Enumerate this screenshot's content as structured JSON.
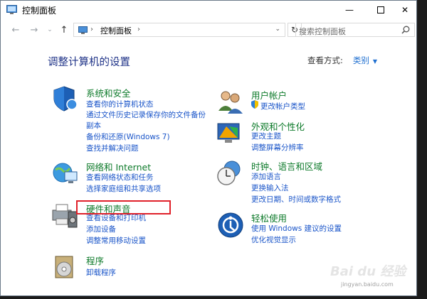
{
  "window": {
    "title": "控制面板"
  },
  "nav": {
    "breadcrumb": "控制面板",
    "search_placeholder": "搜索控制面板"
  },
  "main": {
    "heading": "调整计算机的设置",
    "view_by_label": "查看方式:",
    "view_by_value": "类别"
  },
  "categories": {
    "system": {
      "title": "系统和安全",
      "links": [
        "查看你的计算机状态",
        "通过文件历史记录保存你的文件备份",
        "副本",
        "备份和还原(Windows 7)",
        "查找并解决问题"
      ]
    },
    "network": {
      "title": "网络和 Internet",
      "links": [
        "查看网络状态和任务",
        "选择家庭组和共享选项"
      ]
    },
    "hardware": {
      "title": "硬件和声音",
      "links": [
        "查看设备和打印机",
        "添加设备",
        "调整常用移动设置"
      ]
    },
    "programs": {
      "title": "程序",
      "links": [
        "卸载程序"
      ]
    },
    "user": {
      "title": "用户帐户",
      "links": [
        "更改帐户类型"
      ]
    },
    "appearance": {
      "title": "外观和个性化",
      "links": [
        "更改主题",
        "调整屏幕分辨率"
      ]
    },
    "clock": {
      "title": "时钟、语言和区域",
      "links": [
        "添加语言",
        "更换输入法",
        "更改日期、时间或数字格式"
      ]
    },
    "ease": {
      "title": "轻松使用",
      "links": [
        "使用 Windows 建议的设置",
        "优化视觉显示"
      ]
    }
  },
  "watermark": {
    "text": "Bai du 经验",
    "url": "jingyan.baidu.com"
  },
  "colors": {
    "link": "#1a55c9",
    "category_title": "#0d7a2a",
    "heading": "#1e3287",
    "highlight_box": "#e0212a"
  }
}
